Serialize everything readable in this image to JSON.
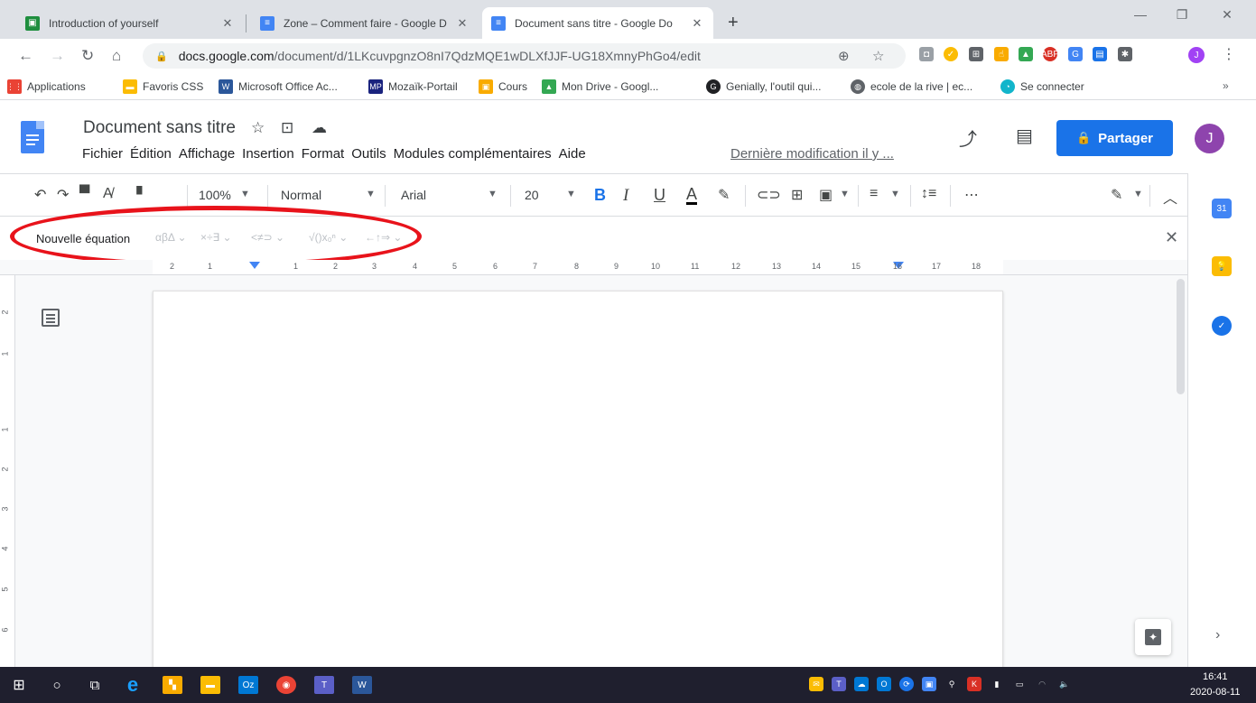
{
  "tabs": [
    {
      "title": "Introduction of yourself",
      "color": "#4285f4",
      "icon": "classroom-icon"
    },
    {
      "title": "Zone – Comment faire - Google D",
      "color": "#4285f4",
      "icon": "docs-icon"
    },
    {
      "title": "Document sans titre - Google Do",
      "color": "#4285f4",
      "icon": "docs-icon",
      "active": true
    }
  ],
  "addressbar": {
    "host": "docs.google.com",
    "path": "/document/d/1LKcuvpgnzO8nI7QdzMQE1wDLXfJJF-UG18XmnyPhGo4/edit"
  },
  "bookmarks": [
    {
      "label": "Applications",
      "icon": "apps-grid-icon",
      "color": "#ea4335"
    },
    {
      "label": "Favoris CSS",
      "icon": "folder-icon",
      "color": "#fbbc04"
    },
    {
      "label": "Microsoft Office Ac...",
      "icon": "word-icon",
      "color": "#2b579a"
    },
    {
      "label": "Mozaïk-Portail",
      "icon": "mozaik-icon",
      "color": "#1a237e"
    },
    {
      "label": "Cours",
      "icon": "classroom-icon",
      "color": "#f9ab00"
    },
    {
      "label": "Mon Drive - Googl...",
      "icon": "drive-icon",
      "color": "#34a853"
    },
    {
      "label": "Genially, l'outil qui...",
      "icon": "genially-icon",
      "color": "#202124"
    },
    {
      "label": "ecole de la rive | ec...",
      "icon": "globe-icon",
      "color": "#5f6368"
    },
    {
      "label": "Se connecter",
      "icon": "connect-icon",
      "color": "#12b5cb"
    }
  ],
  "docs": {
    "title": "Document sans titre",
    "menu": [
      "Fichier",
      "Édition",
      "Affichage",
      "Insertion",
      "Format",
      "Outils",
      "Modules complémentaires",
      "Aide"
    ],
    "last_modified": "Dernière modification il y ...",
    "share_label": "Partager",
    "avatar_letter": "J"
  },
  "toolbar": {
    "zoom": "100%",
    "style": "Normal",
    "font": "Arial",
    "size": "20",
    "bold": "B",
    "italic": "I",
    "underline": "U",
    "textcolor": "A"
  },
  "equation_bar": {
    "label": "Nouvelle équation",
    "groups": [
      "αβΔ ⌄",
      "×÷∃ ⌄",
      "<≠⊃ ⌄",
      "√()x₀ⁿ ⌄",
      "←↑⇒ ⌄"
    ]
  },
  "ruler": {
    "h_numbers": [
      "2",
      "1",
      "1",
      "2",
      "3",
      "4",
      "5",
      "6",
      "7",
      "8",
      "9",
      "10",
      "11",
      "12",
      "13",
      "14",
      "15",
      "16",
      "17",
      "18"
    ],
    "v_numbers": [
      "2",
      "1",
      "1",
      "2",
      "3",
      "4",
      "5",
      "6"
    ]
  },
  "taskbar": {
    "time": "16:41",
    "date": "2020-08-11"
  },
  "colors": {
    "accent": "#1a73e8",
    "annotation": "#e8131b"
  }
}
